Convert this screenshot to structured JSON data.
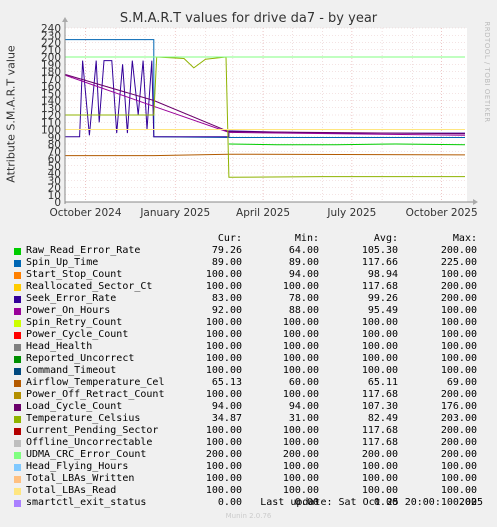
{
  "title": "S.M.A.R.T values for drive da7 - by year",
  "side_text": "RRDTOOL / TOBI OETIKER",
  "chart_data": {
    "type": "line",
    "title": "S.M.A.R.T values for drive da7 - by year",
    "ylabel": "Attribute S.M.A.R.T value",
    "ylim": [
      0,
      240
    ],
    "yticks": [
      0,
      10,
      20,
      30,
      40,
      50,
      60,
      70,
      80,
      90,
      100,
      110,
      120,
      130,
      140,
      150,
      160,
      170,
      180,
      190,
      200,
      210,
      220,
      230,
      240
    ],
    "xlim": [
      "2024-09-10",
      "2025-10-27"
    ],
    "xticks": [
      {
        "label": "October 2024",
        "date": "2024-10-01"
      },
      {
        "label": "January 2025",
        "date": "2025-01-01"
      },
      {
        "label": "April 2025",
        "date": "2025-04-01"
      },
      {
        "label": "July 2025",
        "date": "2025-07-01"
      },
      {
        "label": "October 2025",
        "date": "2025-10-01"
      }
    ],
    "grid": true,
    "reference_lines": [
      100,
      200
    ],
    "series": [
      {
        "name": "Raw_Read_Error_Rate",
        "color": "#00cc00",
        "points": [
          [
            "2025-02-25",
            80
          ],
          [
            "2025-04-15",
            79
          ],
          [
            "2025-06-15",
            79
          ],
          [
            "2025-08-15",
            80
          ],
          [
            "2025-10-25",
            79
          ]
        ]
      },
      {
        "name": "Spin_Up_Time",
        "color": "#0066b3",
        "points": [
          [
            "2024-09-10",
            224
          ],
          [
            "2024-12-10",
            224
          ],
          [
            "2024-12-10",
            90
          ],
          [
            "2025-02-25",
            89
          ],
          [
            "2025-10-25",
            89
          ]
        ]
      },
      {
        "name": "Start_Stop_Count",
        "color": "#ff8000",
        "points": [
          [
            "2024-09-10",
            100
          ],
          [
            "2025-10-25",
            100
          ]
        ]
      },
      {
        "name": "Reallocated_Sector_Ct",
        "color": "#ffcc00",
        "points": [
          [
            "2024-09-10",
            100
          ],
          [
            "2025-10-25",
            100
          ]
        ]
      },
      {
        "name": "Seek_Error_Rate",
        "color": "#330099",
        "points": [
          [
            "2024-09-10",
            90
          ],
          [
            "2024-09-25",
            90
          ],
          [
            "2024-09-28",
            195
          ],
          [
            "2024-10-05",
            92
          ],
          [
            "2024-10-12",
            195
          ],
          [
            "2024-10-15",
            110
          ],
          [
            "2024-10-20",
            195
          ],
          [
            "2024-10-28",
            195
          ],
          [
            "2024-11-02",
            95
          ],
          [
            "2024-11-08",
            190
          ],
          [
            "2024-11-13",
            95
          ],
          [
            "2024-11-18",
            195
          ],
          [
            "2024-11-24",
            120
          ],
          [
            "2024-11-29",
            195
          ],
          [
            "2024-12-03",
            100
          ],
          [
            "2024-12-08",
            195
          ],
          [
            "2024-12-10",
            90
          ],
          [
            "2025-02-25",
            90
          ],
          [
            "2025-02-25",
            98
          ],
          [
            "2025-06-01",
            95
          ],
          [
            "2025-10-25",
            95
          ]
        ]
      },
      {
        "name": "Power_On_Hours",
        "color": "#990099",
        "points": [
          [
            "2024-09-10",
            175
          ],
          [
            "2024-12-10",
            132
          ],
          [
            "2025-02-25",
            96
          ],
          [
            "2025-10-25",
            92
          ]
        ]
      },
      {
        "name": "Spin_Retry_Count",
        "color": "#ccff00",
        "points": [
          [
            "2024-09-10",
            100
          ],
          [
            "2025-10-25",
            100
          ]
        ]
      },
      {
        "name": "Power_Cycle_Count",
        "color": "#ff0000",
        "points": [
          [
            "2024-09-10",
            100
          ],
          [
            "2025-10-25",
            100
          ]
        ]
      },
      {
        "name": "Head_Health",
        "color": "#808080",
        "points": [
          [
            "2024-09-10",
            100
          ],
          [
            "2025-10-25",
            100
          ]
        ]
      },
      {
        "name": "Reported_Uncorrect",
        "color": "#008f00",
        "points": [
          [
            "2024-09-10",
            100
          ],
          [
            "2025-10-25",
            100
          ]
        ]
      },
      {
        "name": "Command_Timeout",
        "color": "#00487d",
        "points": [
          [
            "2024-09-10",
            100
          ],
          [
            "2025-10-25",
            100
          ]
        ]
      },
      {
        "name": "Airflow_Temperature_Cel",
        "color": "#b35a00",
        "points": [
          [
            "2024-09-10",
            64
          ],
          [
            "2024-12-10",
            64
          ],
          [
            "2025-02-25",
            66
          ],
          [
            "2025-10-25",
            65
          ]
        ]
      },
      {
        "name": "Power_Off_Retract_Count",
        "color": "#b38f00",
        "points": [
          [
            "2024-09-10",
            100
          ],
          [
            "2025-10-25",
            100
          ]
        ]
      },
      {
        "name": "Load_Cycle_Count",
        "color": "#6b006b",
        "points": [
          [
            "2024-09-10",
            176
          ],
          [
            "2024-12-10",
            140
          ],
          [
            "2025-02-25",
            97
          ],
          [
            "2025-10-25",
            94
          ]
        ]
      },
      {
        "name": "Temperature_Celsius",
        "color": "#8fb300",
        "points": [
          [
            "2024-09-10",
            120
          ],
          [
            "2024-12-10",
            120
          ],
          [
            "2024-12-13",
            200
          ],
          [
            "2025-01-10",
            198
          ],
          [
            "2025-01-20",
            185
          ],
          [
            "2025-02-01",
            197
          ],
          [
            "2025-02-22",
            200
          ],
          [
            "2025-02-25",
            34
          ],
          [
            "2025-06-01",
            35
          ],
          [
            "2025-10-25",
            35
          ]
        ]
      },
      {
        "name": "Current_Pending_Sector",
        "color": "#b30000",
        "points": [
          [
            "2024-09-10",
            100
          ],
          [
            "2025-10-25",
            100
          ]
        ]
      },
      {
        "name": "Offline_Uncorrectable",
        "color": "#bebebe",
        "points": [
          [
            "2024-09-10",
            100
          ],
          [
            "2025-10-25",
            100
          ]
        ]
      },
      {
        "name": "UDMA_CRC_Error_Count",
        "color": "#80ff80",
        "points": [
          [
            "2024-09-10",
            200
          ],
          [
            "2025-10-25",
            200
          ]
        ]
      },
      {
        "name": "Head_Flying_Hours",
        "color": "#80c9ff",
        "points": [
          [
            "2024-09-10",
            100
          ],
          [
            "2025-10-25",
            100
          ]
        ]
      },
      {
        "name": "Total_LBAs_Written",
        "color": "#ffc080",
        "points": [
          [
            "2024-09-10",
            100
          ],
          [
            "2025-10-25",
            100
          ]
        ]
      },
      {
        "name": "Total_LBAs_Read",
        "color": "#ffe680",
        "points": [
          [
            "2024-09-10",
            100
          ],
          [
            "2025-10-25",
            100
          ]
        ]
      },
      {
        "name": "smartctl_exit_status",
        "color": "#aa80ff",
        "points": [
          [
            "2024-09-10",
            0
          ],
          [
            "2025-10-25",
            0
          ]
        ]
      }
    ]
  },
  "legend": {
    "headers": [
      "Cur:",
      "Min:",
      "Avg:",
      "Max:"
    ],
    "rows": [
      {
        "name": "Raw_Read_Error_Rate",
        "color": "#00cc00",
        "cur": "79.26",
        "min": "64.00",
        "avg": "105.30",
        "max": "200.00"
      },
      {
        "name": "Spin_Up_Time",
        "color": "#0066b3",
        "cur": "89.00",
        "min": "89.00",
        "avg": "117.66",
        "max": "225.00"
      },
      {
        "name": "Start_Stop_Count",
        "color": "#ff8000",
        "cur": "100.00",
        "min": "94.00",
        "avg": "98.94",
        "max": "100.00"
      },
      {
        "name": "Reallocated_Sector_Ct",
        "color": "#ffcc00",
        "cur": "100.00",
        "min": "100.00",
        "avg": "117.68",
        "max": "200.00"
      },
      {
        "name": "Seek_Error_Rate",
        "color": "#330099",
        "cur": "83.00",
        "min": "78.00",
        "avg": "99.26",
        "max": "200.00"
      },
      {
        "name": "Power_On_Hours",
        "color": "#990099",
        "cur": "92.00",
        "min": "88.00",
        "avg": "95.49",
        "max": "100.00"
      },
      {
        "name": "Spin_Retry_Count",
        "color": "#ccff00",
        "cur": "100.00",
        "min": "100.00",
        "avg": "100.00",
        "max": "100.00"
      },
      {
        "name": "Power_Cycle_Count",
        "color": "#ff0000",
        "cur": "100.00",
        "min": "100.00",
        "avg": "100.00",
        "max": "100.00"
      },
      {
        "name": "Head_Health",
        "color": "#808080",
        "cur": "100.00",
        "min": "100.00",
        "avg": "100.00",
        "max": "100.00"
      },
      {
        "name": "Reported_Uncorrect",
        "color": "#008f00",
        "cur": "100.00",
        "min": "100.00",
        "avg": "100.00",
        "max": "100.00"
      },
      {
        "name": "Command_Timeout",
        "color": "#00487d",
        "cur": "100.00",
        "min": "100.00",
        "avg": "100.00",
        "max": "100.00"
      },
      {
        "name": "Airflow_Temperature_Cel",
        "color": "#b35a00",
        "cur": "65.13",
        "min": "60.00",
        "avg": "65.11",
        "max": "69.00"
      },
      {
        "name": "Power_Off_Retract_Count",
        "color": "#b38f00",
        "cur": "100.00",
        "min": "100.00",
        "avg": "117.68",
        "max": "200.00"
      },
      {
        "name": "Load_Cycle_Count",
        "color": "#6b006b",
        "cur": "94.00",
        "min": "94.00",
        "avg": "107.30",
        "max": "176.00"
      },
      {
        "name": "Temperature_Celsius",
        "color": "#8fb300",
        "cur": "34.87",
        "min": "31.00",
        "avg": "82.49",
        "max": "203.00"
      },
      {
        "name": "Current_Pending_Sector",
        "color": "#b30000",
        "cur": "100.00",
        "min": "100.00",
        "avg": "117.68",
        "max": "200.00"
      },
      {
        "name": "Offline_Uncorrectable",
        "color": "#bebebe",
        "cur": "100.00",
        "min": "100.00",
        "avg": "117.68",
        "max": "200.00"
      },
      {
        "name": "UDMA_CRC_Error_Count",
        "color": "#80ff80",
        "cur": "200.00",
        "min": "200.00",
        "avg": "200.00",
        "max": "200.00"
      },
      {
        "name": "Head_Flying_Hours",
        "color": "#80c9ff",
        "cur": "100.00",
        "min": "100.00",
        "avg": "100.00",
        "max": "100.00"
      },
      {
        "name": "Total_LBAs_Written",
        "color": "#ffc080",
        "cur": "100.00",
        "min": "100.00",
        "avg": "100.00",
        "max": "100.00"
      },
      {
        "name": "Total_LBAs_Read",
        "color": "#ffe680",
        "cur": "100.00",
        "min": "100.00",
        "avg": "100.00",
        "max": "100.00"
      },
      {
        "name": "smartctl_exit_status",
        "color": "#aa80ff",
        "cur": "0.00",
        "min": "0.00",
        "avg": "0.00",
        "max": "0.00"
      }
    ]
  },
  "last_update": "Last update: Sat Oct 25 20:00:10 2025",
  "munin_version": "Munin 2.0.76"
}
